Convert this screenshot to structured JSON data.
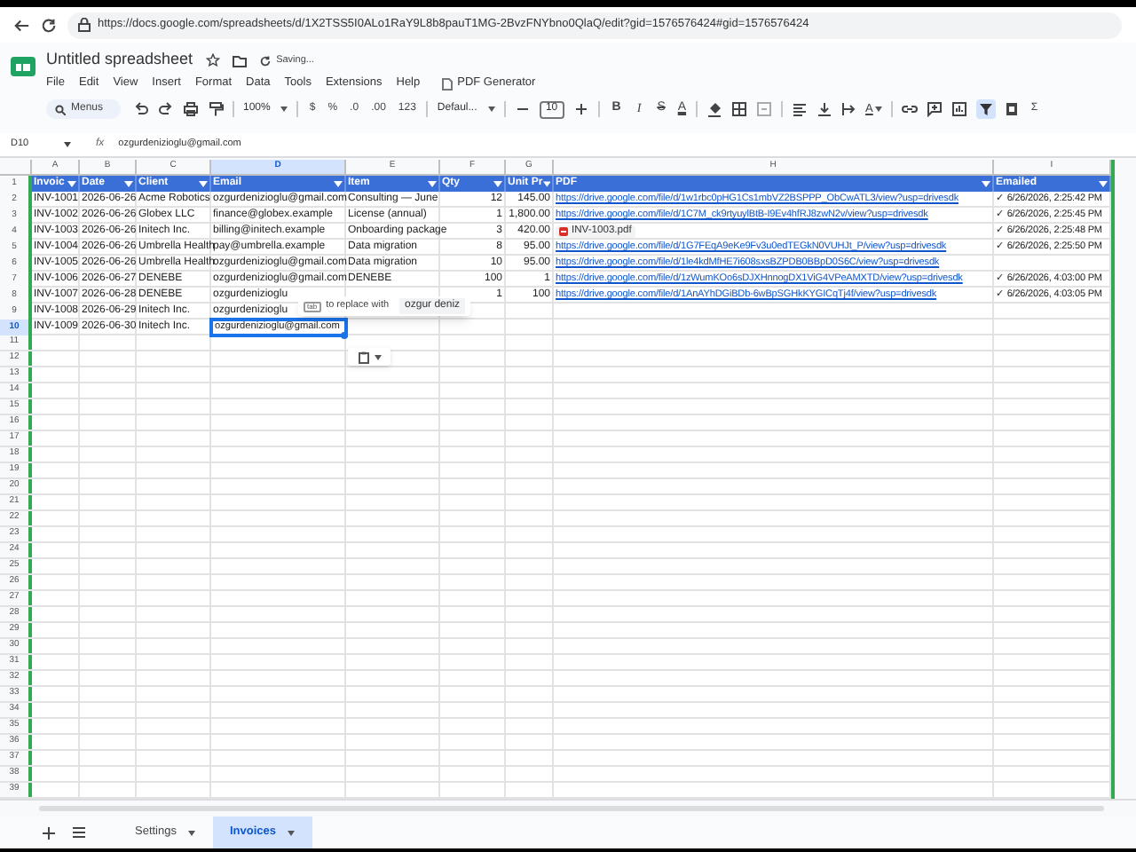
{
  "browser": {
    "url": "https://docs.google.com/spreadsheets/d/1X2TSS5I0ALo1RaY9L8b8pauT1MG-2BvzFNYbno0QlaQ/edit?gid=1576576424#gid=1576576424"
  },
  "document": {
    "title": "Untitled spreadsheet",
    "save_status": "Saving..."
  },
  "menu": [
    "File",
    "Edit",
    "View",
    "Insert",
    "Format",
    "Data",
    "Tools",
    "Extensions",
    "Help"
  ],
  "addon_menu": "PDF Generator",
  "toolbar": [
    {
      "kind": "search",
      "label": "Menus"
    },
    {
      "kind": "undo"
    },
    {
      "kind": "redo"
    },
    {
      "kind": "print"
    },
    {
      "kind": "paint"
    },
    {
      "kind": "divider"
    },
    {
      "kind": "dropdown",
      "label": "100%"
    },
    {
      "kind": "divider"
    },
    {
      "kind": "text",
      "label": "$"
    },
    {
      "kind": "text",
      "label": "%"
    },
    {
      "kind": "text",
      "label": ".0"
    },
    {
      "kind": "text",
      "label": ".00"
    },
    {
      "kind": "text",
      "label": "123"
    },
    {
      "kind": "divider"
    },
    {
      "kind": "dropdown",
      "label": "Defaul..."
    },
    {
      "kind": "divider"
    },
    {
      "kind": "minus"
    },
    {
      "kind": "size",
      "label": "10"
    },
    {
      "kind": "plus"
    },
    {
      "kind": "divider"
    },
    {
      "kind": "style",
      "label": "B",
      "on": false
    },
    {
      "kind": "style",
      "label": "I",
      "on": false
    },
    {
      "kind": "style",
      "label": "S",
      "on": false
    },
    {
      "kind": "textcolor",
      "label": "A"
    },
    {
      "kind": "divider"
    },
    {
      "kind": "fill"
    },
    {
      "kind": "borders"
    },
    {
      "kind": "merge"
    },
    {
      "kind": "divider"
    },
    {
      "kind": "align"
    },
    {
      "kind": "valign"
    },
    {
      "kind": "wrap"
    },
    {
      "kind": "rotate",
      "label": "A"
    },
    {
      "kind": "divider"
    },
    {
      "kind": "link"
    },
    {
      "kind": "comment"
    },
    {
      "kind": "chart"
    },
    {
      "kind": "filter",
      "on": true
    },
    {
      "kind": "filterviews"
    },
    {
      "kind": "text",
      "label": "Σ"
    }
  ],
  "formula_bar": {
    "cell_ref": "D10",
    "fx": "fx",
    "value": "ozgurdenizioglu@gmail.com"
  },
  "columns": [
    {
      "letter": "A",
      "selected": false
    },
    {
      "letter": "B",
      "selected": false
    },
    {
      "letter": "C",
      "selected": false
    },
    {
      "letter": "D",
      "selected": true
    },
    {
      "letter": "E",
      "selected": false
    },
    {
      "letter": "F",
      "selected": false
    },
    {
      "letter": "G",
      "selected": false
    },
    {
      "letter": "H",
      "selected": false
    },
    {
      "letter": "I",
      "selected": false
    }
  ],
  "rows": [
    {
      "number": "1",
      "selected": false,
      "kind": "header",
      "cells": {
        "A": "Invoic",
        "B": "Date",
        "C": "Client",
        "D": "Email",
        "E": "Item",
        "F": "Qty",
        "G": "Unit Pr",
        "H": "PDF",
        "I": "Emailed"
      }
    },
    {
      "number": "2",
      "selected": false,
      "kind": "data",
      "cells": {
        "A": "INV-1001",
        "B": "2026-06-26",
        "C": "Acme Robotics",
        "D": "ozgurdenizioglu@gmail.com",
        "E": "Consulting — June",
        "F": "12",
        "G": "145.00",
        "H": {
          "kind": "link",
          "text": "https://drive.google.com/file/d/1w1rbc0pHG1Cs1mbVZ2BSPPP_ObCwATL3/view?usp=drivesdk"
        },
        "I": "✓ 6/26/2026, 2:25:42 PM"
      }
    },
    {
      "number": "3",
      "selected": false,
      "kind": "data",
      "cells": {
        "A": "INV-1002",
        "B": "2026-06-26",
        "C": "Globex LLC",
        "D": "finance@globex.example",
        "E": "License (annual)",
        "F": "1",
        "G": "1,800.00",
        "H": {
          "kind": "link",
          "text": "https://drive.google.com/file/d/1C7M_ck9rtyuylBtB-I9Ev4hfRJ8zwN2v/view?usp=drivesdk"
        },
        "I": "✓ 6/26/2026, 2:25:45 PM"
      }
    },
    {
      "number": "4",
      "selected": false,
      "kind": "data",
      "cells": {
        "A": "INV-1003",
        "B": "2026-06-26",
        "C": "Initech Inc.",
        "D": "billing@initech.example",
        "E": "Onboarding package",
        "F": "3",
        "G": "420.00",
        "H": {
          "kind": "chip",
          "text": "INV-1003.pdf"
        },
        "I": "✓ 6/26/2026, 2:25:48 PM"
      }
    },
    {
      "number": "5",
      "selected": false,
      "kind": "data",
      "cells": {
        "A": "INV-1004",
        "B": "2026-06-26",
        "C": "Umbrella Health",
        "D": "pay@umbrella.example",
        "E": "Data migration",
        "F": "8",
        "G": "95.00",
        "H": {
          "kind": "link",
          "text": "https://drive.google.com/file/d/1G7FEqA9eKe9Fv3u0edTEGkN0VUHJt_P/view?usp=drivesdk"
        },
        "I": "✓ 6/26/2026, 2:25:50 PM"
      }
    },
    {
      "number": "6",
      "selected": false,
      "kind": "data",
      "cells": {
        "A": "INV-1005",
        "B": "2026-06-26",
        "C": "Umbrella Health",
        "D": "ozgurdenizioglu@gmail.com",
        "E": "Data migration",
        "F": "10",
        "G": "95.00",
        "H": {
          "kind": "link",
          "text": "https://drive.google.com/file/d/1le4kdMfHE7i608sxsBZPDB0BBpD0S6C/view?usp=drivesdk"
        }
      }
    },
    {
      "number": "7",
      "selected": false,
      "kind": "data",
      "cells": {
        "A": "INV-1006",
        "B": "2026-06-27",
        "C": "DENEBE",
        "D": "ozgurdenizioglu@gmail.com",
        "E": "DENEBE",
        "F": "100",
        "G": "1",
        "H": {
          "kind": "link",
          "text": "https://drive.google.com/file/d/1zWumKOo6sDJXHnnogDX1ViG4VPeAMXTD/view?usp=drivesdk"
        },
        "I": "✓ 6/26/2026, 4:03:00 PM"
      }
    },
    {
      "number": "8",
      "selected": false,
      "kind": "data",
      "cells": {
        "A": "INV-1007",
        "B": "2026-06-28",
        "C": "DENEBE",
        "D": "ozgurdenizioglu",
        "F": "1",
        "G": "100",
        "H": {
          "kind": "link",
          "text": "https://drive.google.com/file/d/1AnAYhDGiBDb-6wBpSGHkKYGICqTj4f/view?usp=drivesdk"
        },
        "I": "✓ 6/26/2026, 4:03:05 PM"
      }
    },
    {
      "number": "9",
      "selected": false,
      "kind": "data",
      "cells": {
        "A": "INV-1008",
        "B": "2026-06-29",
        "C": "Initech Inc.",
        "D": "ozgurdenizioglu"
      }
    },
    {
      "number": "10",
      "selected": true,
      "kind": "data",
      "cells": {
        "A": "INV-1009",
        "B": "2026-06-30",
        "C": "Initech Inc.",
        "D": {
          "kind": "active",
          "text": "ozgurdenizioglu@gmail.com"
        }
      }
    },
    {
      "number": "11",
      "selected": false
    },
    {
      "number": "12",
      "selected": false
    },
    {
      "number": "13",
      "selected": false
    },
    {
      "number": "14",
      "selected": false
    },
    {
      "number": "15",
      "selected": false
    },
    {
      "number": "16",
      "selected": false
    },
    {
      "number": "17",
      "selected": false
    },
    {
      "number": "18",
      "selected": false
    },
    {
      "number": "19",
      "selected": false
    },
    {
      "number": "20",
      "selected": false
    },
    {
      "number": "21",
      "selected": false
    },
    {
      "number": "22",
      "selected": false
    },
    {
      "number": "23",
      "selected": false
    },
    {
      "number": "24",
      "selected": false
    },
    {
      "number": "25",
      "selected": false
    },
    {
      "number": "26",
      "selected": false
    },
    {
      "number": "27",
      "selected": false
    },
    {
      "number": "28",
      "selected": false
    },
    {
      "number": "29",
      "selected": false
    },
    {
      "number": "30",
      "selected": false
    },
    {
      "number": "31",
      "selected": false
    },
    {
      "number": "32",
      "selected": false
    },
    {
      "number": "33",
      "selected": false
    },
    {
      "number": "34",
      "selected": false
    },
    {
      "number": "35",
      "selected": false
    },
    {
      "number": "36",
      "selected": false
    },
    {
      "number": "37",
      "selected": false
    },
    {
      "number": "38",
      "selected": false
    },
    {
      "number": "39",
      "selected": false
    }
  ],
  "autocomplete": {
    "key": "tab",
    "hint": "to replace with",
    "suggestion": "ozgur deniz"
  },
  "sheet_tabs": [
    {
      "label": "Settings",
      "selected": false
    },
    {
      "label": "Invoices",
      "selected": true
    }
  ]
}
